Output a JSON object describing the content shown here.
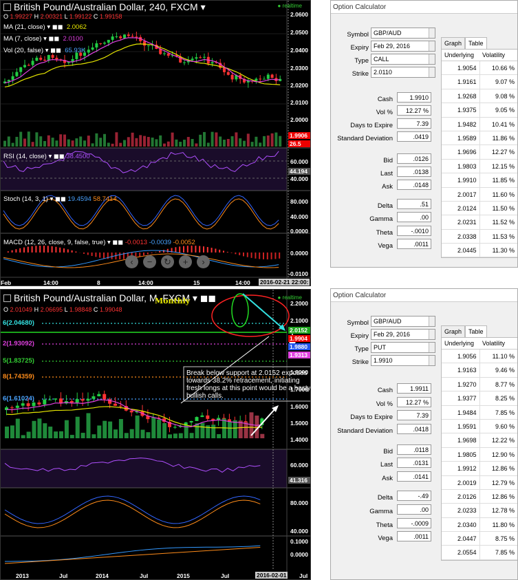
{
  "top_chart": {
    "title": "British Pound/Australian Dollar, 240, FXCM",
    "ohlc": {
      "o_label": "O",
      "o": "1.99227",
      "h_label": "H",
      "h": "2.00321",
      "l_label": "L",
      "l": "1.99122",
      "c_label": "C",
      "c": "1.99158"
    },
    "realtime": "realtime",
    "indicators": {
      "ma21": "MA (21, close)",
      "ma21_val": "2.0062",
      "ma7": "MA (7, close)",
      "ma7_val": "2.0100",
      "vol": "Vol (20, false)",
      "vol_val": "65.93K"
    },
    "price_axis": [
      "2.0600",
      "2.0500",
      "2.0400",
      "2.0300",
      "2.0200",
      "2.0100",
      "2.0000"
    ],
    "price_tags": [
      "1.9906",
      "26.5"
    ],
    "rsi": {
      "label": "RSI (14, close)",
      "value": "38.4500",
      "axis": [
        "60.000",
        "44.194",
        "40.000"
      ]
    },
    "stoch": {
      "label": "Stoch (14, 3, 1)",
      "k": "19.4594",
      "d": "58.7414",
      "axis": [
        "80.000",
        "40.000",
        "0.0000"
      ]
    },
    "macd": {
      "label": "MACD (12, 26, close, 9, false, true)",
      "v1": "-0.0013",
      "v2": "-0.0039",
      "v3": "-0.0052",
      "axis": [
        "0.0000",
        "-0.0100"
      ]
    },
    "xaxis": [
      "Feb",
      "14:00",
      "8",
      "14:00",
      "15",
      "14:00"
    ],
    "cursor_date": "2016-02-21 22:00:"
  },
  "bot_chart": {
    "title": "British Pound/Australian Dollar, M, FXCM",
    "monthly": "Monthly",
    "ohlc": {
      "o_label": "O",
      "o": "2.01049",
      "h_label": "H",
      "h": "2.06695",
      "l_label": "L",
      "l": "1.98848",
      "c_label": "C",
      "c": "1.99048"
    },
    "realtime": "realtime",
    "price_axis": [
      "2.2000",
      "2.1000",
      "1.8000",
      "1.7000",
      "1.6000",
      "1.5000",
      "1.4000"
    ],
    "price_tags": [
      "2.0152",
      "1.9904",
      "1.9880",
      "1.9313"
    ],
    "fibs": [
      {
        "label": "6(2.04680)",
        "color": "#33e0e0"
      },
      {
        "label": "2(1.93092)",
        "color": "#e040e0"
      },
      {
        "label": "5(1.83725)",
        "color": "#33cc33"
      },
      {
        "label": "8(1.74359)",
        "color": "#ff8c1a"
      },
      {
        "label": "6(1.61024)",
        "color": "#4aa3ff"
      }
    ],
    "note": "Break below support at 2.0152 exposes towards 38.2% retracement, initiating fresh longs at this point would be a hasty bullish calls.",
    "rsi_axis": [
      "60.000",
      "41.316"
    ],
    "stoch_axis": [
      "80.000",
      "40.000"
    ],
    "macd_axis": [
      "0.1000",
      "0.0000"
    ],
    "xaxis": [
      "2013",
      "Jul",
      "2014",
      "Jul",
      "2015",
      "Jul",
      "Jul"
    ],
    "cursor_date": "2016-02-01"
  },
  "calc_top": {
    "title": "Option Calculator",
    "symbol_label": "Symbol",
    "symbol": "GBP/AUD",
    "expiry_label": "Expiry",
    "expiry": "Feb 29, 2016",
    "type_label": "Type",
    "type": "CALL",
    "strike_label": "Strike",
    "strike": "2.0110",
    "cash_label": "Cash",
    "cash": "1.9910",
    "vol_label": "Vol %",
    "vol": "12.27 %",
    "days_label": "Days to Expire",
    "days": "7.39",
    "sd_label": "Standard Deviation",
    "sd": ".0419",
    "bid_label": "Bid",
    "bid": ".0126",
    "last_label": "Last",
    "last": ".0138",
    "ask_label": "Ask",
    "ask": ".0148",
    "delta_label": "Delta",
    "delta": ".51",
    "gamma_label": "Gamma",
    "gamma": ".00",
    "theta_label": "Theta",
    "theta": "-.0010",
    "vega_label": "Vega",
    "vega": ".0011",
    "tab_graph": "Graph",
    "tab_table": "Table",
    "col_under": "Underlying",
    "col_vol": "Volatility",
    "rows": [
      [
        "1.9054",
        "10.66 %"
      ],
      [
        "1.9161",
        "9.07 %"
      ],
      [
        "1.9268",
        "9.08 %"
      ],
      [
        "1.9375",
        "9.05 %"
      ],
      [
        "1.9482",
        "10.41 %"
      ],
      [
        "1.9589",
        "11.86 %"
      ],
      [
        "1.9696",
        "12.27 %"
      ],
      [
        "1.9803",
        "12.15 %"
      ],
      [
        "1.9910",
        "11.85 %"
      ],
      [
        "2.0017",
        "11.60 %"
      ],
      [
        "2.0124",
        "11.50 %"
      ],
      [
        "2.0231",
        "11.52 %"
      ],
      [
        "2.0338",
        "11.53 %"
      ],
      [
        "2.0445",
        "11.30 %"
      ]
    ]
  },
  "calc_bot": {
    "title": "Option Calculator",
    "symbol_label": "Symbol",
    "symbol": "GBP/AUD",
    "expiry_label": "Expiry",
    "expiry": "Feb 29, 2016",
    "type_label": "Type",
    "type": "PUT",
    "strike_label": "Strike",
    "strike": "1.9910",
    "cash_label": "Cash",
    "cash": "1.9911",
    "vol_label": "Vol %",
    "vol": "12.27 %",
    "days_label": "Days to Expire",
    "days": "7.39",
    "sd_label": "Standard Deviation",
    "sd": ".0418",
    "bid_label": "Bid",
    "bid": ".0118",
    "last_label": "Last",
    "last": ".0131",
    "ask_label": "Ask",
    "ask": ".0141",
    "delta_label": "Delta",
    "delta": "-.49",
    "gamma_label": "Gamma",
    "gamma": ".00",
    "theta_label": "Theta",
    "theta": "-.0009",
    "vega_label": "Vega",
    "vega": ".0011",
    "tab_graph": "Graph",
    "tab_table": "Table",
    "col_under": "Underlying",
    "col_vol": "Volatility",
    "rows": [
      [
        "1.9056",
        "11.10 %"
      ],
      [
        "1.9163",
        "9.46 %"
      ],
      [
        "1.9270",
        "8.77 %"
      ],
      [
        "1.9377",
        "8.25 %"
      ],
      [
        "1.9484",
        "7.85 %"
      ],
      [
        "1.9591",
        "9.60 %"
      ],
      [
        "1.9698",
        "12.22 %"
      ],
      [
        "1.9805",
        "12.90 %"
      ],
      [
        "1.9912",
        "12.86 %"
      ],
      [
        "2.0019",
        "12.79 %"
      ],
      [
        "2.0126",
        "12.86 %"
      ],
      [
        "2.0233",
        "12.78 %"
      ],
      [
        "2.0340",
        "11.80 %"
      ],
      [
        "2.0447",
        "8.75 %"
      ],
      [
        "2.0554",
        "7.85 %"
      ]
    ]
  },
  "colors": {
    "up": "#22cc44",
    "down": "#ff3333",
    "ma_slow": "#e6e600",
    "ma_fast": "#e040e0",
    "bg": "#000000"
  }
}
